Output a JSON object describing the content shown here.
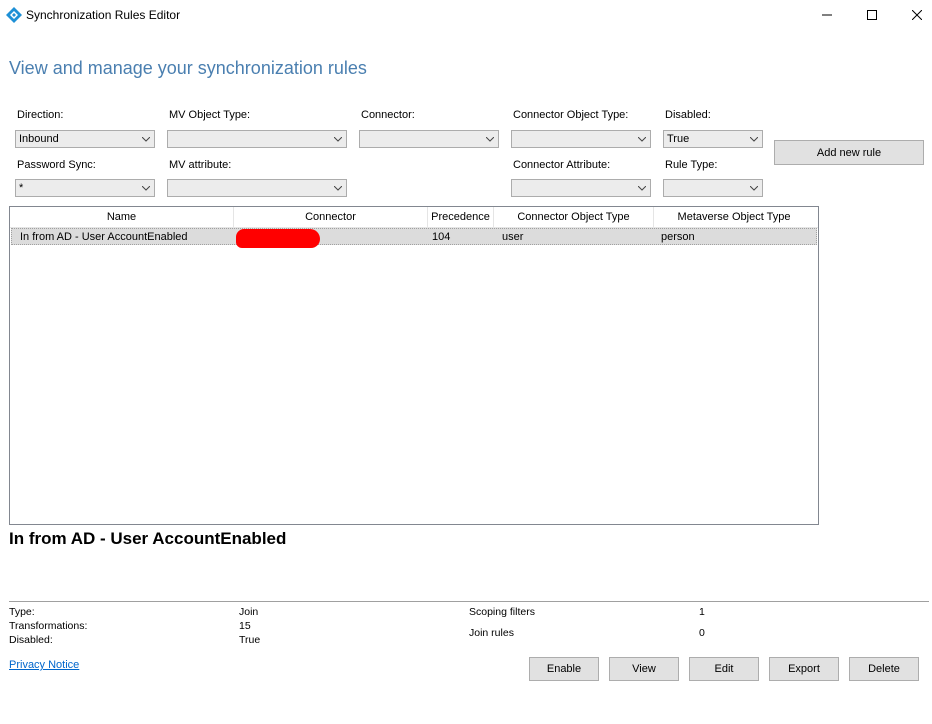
{
  "window": {
    "title": "Synchronization Rules Editor",
    "controls": {
      "minimize": "minimize",
      "maximize": "maximize",
      "close": "close"
    }
  },
  "heading": "View and manage your synchronization rules",
  "filters": {
    "direction": {
      "label": "Direction:",
      "value": "Inbound"
    },
    "mv_object_type": {
      "label": "MV Object Type:",
      "value": ""
    },
    "connector": {
      "label": "Connector:",
      "value": ""
    },
    "connector_object_type": {
      "label": "Connector Object Type:",
      "value": ""
    },
    "disabled": {
      "label": "Disabled:",
      "value": "True"
    },
    "password_sync": {
      "label": "Password Sync:",
      "value": "*"
    },
    "mv_attribute": {
      "label": "MV attribute:",
      "value": ""
    },
    "connector_attribute": {
      "label": "Connector Attribute:",
      "value": ""
    },
    "rule_type": {
      "label": "Rule Type:",
      "value": ""
    }
  },
  "add_rule_button": "Add new rule",
  "grid": {
    "columns": [
      "Name",
      "Connector",
      "Precedence",
      "Connector Object Type",
      "Metaverse Object Type"
    ],
    "rows": [
      {
        "name": "In from AD - User AccountEnabled",
        "connector": "",
        "precedence": "104",
        "connector_object_type": "user",
        "metaverse_object_type": "person"
      }
    ]
  },
  "selected_rule": {
    "title": "In from AD - User AccountEnabled",
    "type_label": "Type:",
    "type_value": "Join",
    "transformations_label": "Transformations:",
    "transformations_value": "15",
    "disabled_label": "Disabled:",
    "disabled_value": "True",
    "scoping_filters_label": "Scoping filters",
    "scoping_filters_value": "1",
    "join_rules_label": "Join rules",
    "join_rules_value": "0"
  },
  "privacy_link": "Privacy Notice",
  "actions": {
    "enable": "Enable",
    "view": "View",
    "edit": "Edit",
    "export": "Export",
    "delete": "Delete"
  },
  "colors": {
    "heading": "#4a7fb0",
    "icon": "#1e90d6",
    "redaction": "#ff0000",
    "link": "#0066cc"
  }
}
